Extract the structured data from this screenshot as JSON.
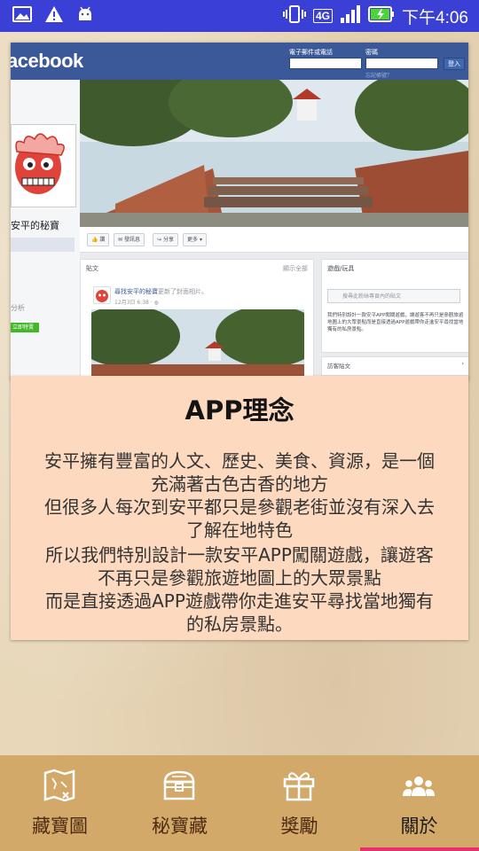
{
  "status_bar": {
    "time": "下午4:06",
    "network": "4G"
  },
  "fb_screenshot": {
    "logo": "acebook",
    "email_label": "電子郵件或電話",
    "password_label": "密碼",
    "login_button": "登入",
    "forgot_link": "忘記帳號？",
    "page_name": "安平的秘寶",
    "side_label": "分析",
    "side_badge": "立即特賣",
    "actions": [
      "讚",
      "發訊息",
      "分享",
      "更多"
    ],
    "posts_header": "貼文",
    "posts_see_all": "顯示全部",
    "post_author": "尋找安平的秘寶",
    "post_action": "更新了封面相片。",
    "post_date": "12月3日 6:38 · ",
    "right_header": "遊戲/玩具",
    "right_search": "搜尋此粉絲專頁內的貼文",
    "right_desc": "我們特別設計一款安平APP闖關遊戲，讓遊客不再只是參觀旅遊地圖上的大眾景點而是直接透過APP遊戲帶你走進安平尋找當地獨有的私房景點。",
    "right_visitor": "訪客貼文"
  },
  "info_card": {
    "title": "APP理念",
    "lines": [
      "安平擁有豐富的人文、歷史、美食、資源，是一個",
      "充滿著古色古香的地方",
      "但很多人每次到安平都只是參觀老街並沒有深入去",
      "了解在地特色",
      "所以我們特別設計一款安平APP闖關遊戲，讓遊客",
      "不再只是參觀旅遊地圖上的大眾景點",
      "而是直接透過APP遊戲帶你走進安平尋找當地獨有",
      "的私房景點。"
    ]
  },
  "bottom_nav": {
    "items": [
      {
        "label": "藏寶圖",
        "icon": "treasure-map-icon"
      },
      {
        "label": "秘寶藏",
        "icon": "treasure-chest-icon"
      },
      {
        "label": "獎勵",
        "icon": "gift-icon"
      },
      {
        "label": "關於",
        "icon": "group-icon"
      }
    ],
    "active_index": 3
  },
  "colors": {
    "status_bar": "#3a3fd6",
    "facebook_blue": "#3b5998",
    "info_card_bg": "#fcd9bf",
    "nav_bg": "#d3a96a",
    "active_indicator": "#e4326b"
  }
}
